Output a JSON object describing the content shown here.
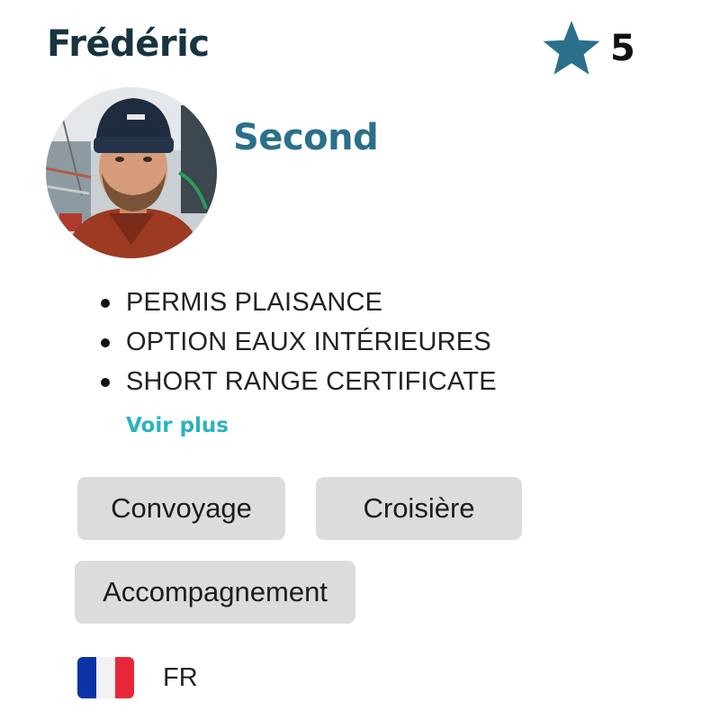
{
  "profile": {
    "name": "Frédéric",
    "role": "Second",
    "rating": "5",
    "rating_icon": "star-icon",
    "avatar_alt": "photo-avatar"
  },
  "certifications": [
    "PERMIS PLAISANCE",
    "OPTION EAUX INTÉRIEURES",
    "SHORT RANGE CERTIFICATE"
  ],
  "more_link": "Voir plus",
  "tags": [
    "Convoyage",
    "Croisière",
    "Accompagnement"
  ],
  "language": {
    "code": "FR",
    "flag_icon": "france-flag-icon"
  },
  "colors": {
    "name": "#17343f",
    "role": "#2b6f8c",
    "star": "#2b6f8c",
    "link": "#2bb3c0",
    "tag_bg": "#dcdcdc",
    "flag_blue": "#0a33a8",
    "flag_white": "#f2f2f2",
    "flag_red": "#e8283a"
  }
}
